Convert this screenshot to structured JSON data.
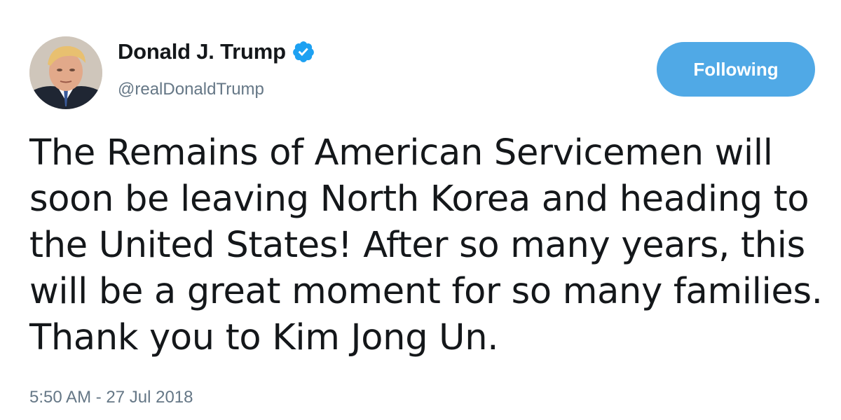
{
  "author": {
    "display_name": "Donald J. Trump",
    "screen_name": "@realDonaldTrump",
    "verified_icon": "verified-badge-icon",
    "avatar_icon": "profile-photo"
  },
  "follow_button": {
    "label": "Following"
  },
  "tweet": {
    "lines": [
      "The Remains of American Servicemen will",
      "soon be leaving North Korea and heading to",
      "the United States! After so many years, this",
      "will be a great moment for so many families.",
      "Thank you to Kim Jong Un."
    ],
    "timestamp": "5:50 AM - 27 Jul 2018"
  },
  "colors": {
    "accent": "#1da1f2",
    "button": "#50a9e6",
    "secondary_text": "#657786",
    "primary_text": "#14171a"
  }
}
